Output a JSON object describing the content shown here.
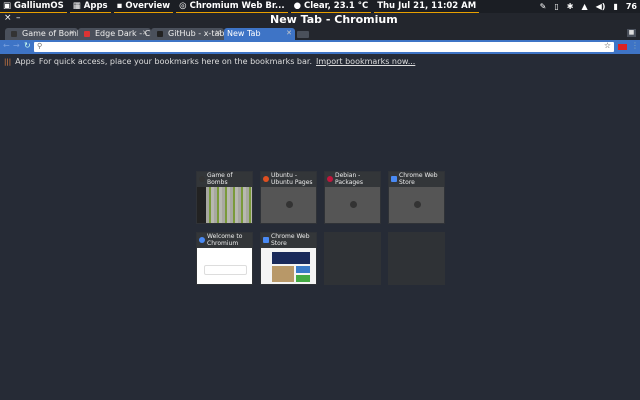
{
  "panel": {
    "items": [
      {
        "icon": "gallium-logo-icon",
        "label": "GalliumOS"
      },
      {
        "icon": "apps-grid-icon",
        "label": "Apps"
      },
      {
        "icon": "overview-icon",
        "label": "Overview"
      },
      {
        "icon": "chromium-icon",
        "label": "Chromium Web Br..."
      },
      {
        "icon": "weather-icon",
        "label": "Clear, 23.1 °C"
      }
    ],
    "clock": "Thu Jul 21, 11:02 AM",
    "battery": "76"
  },
  "window": {
    "title": "New Tab - Chromium",
    "close": "×",
    "minimize": "–"
  },
  "tabs": [
    {
      "label": "Game of Bombs",
      "color": "#333"
    },
    {
      "label": "Edge Dark - Chrome",
      "color": "#d33"
    },
    {
      "label": "GitHub - x-tab",
      "color": "#222"
    },
    {
      "label": "New Tab",
      "active": true
    }
  ],
  "bookmarks": {
    "apps": "Apps",
    "text": "For quick access, place your bookmarks here on the bookmarks bar.",
    "link": "Import bookmarks now..."
  },
  "tiles": [
    {
      "title": "Game of Bombs",
      "color": "#333"
    },
    {
      "title": "Ubuntu - Ubuntu Pages",
      "color": "#e05020"
    },
    {
      "title": "Debian - Packages",
      "color": "#c0163c"
    },
    {
      "title": "Chrome Web Store",
      "color": "#4a8af4"
    },
    {
      "title": "Welcome to Chromium",
      "color": "#4a8af4"
    },
    {
      "title": "Chrome Web Store",
      "color": "#4a8af4"
    }
  ],
  "accent": "#3e74c6"
}
